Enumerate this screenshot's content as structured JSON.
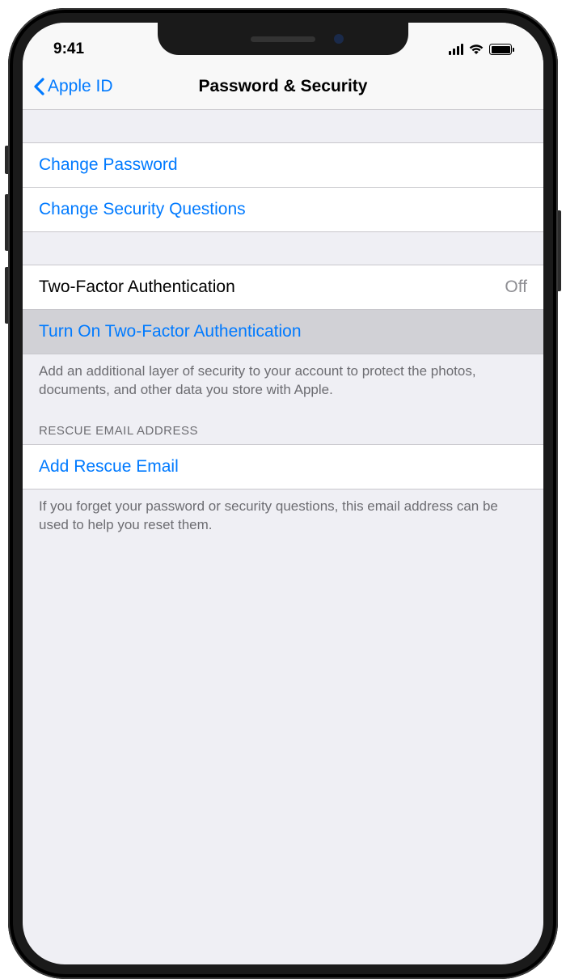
{
  "status_bar": {
    "time": "9:41"
  },
  "nav": {
    "back_label": "Apple ID",
    "title": "Password & Security"
  },
  "sections": {
    "change_password": "Change Password",
    "change_security_questions": "Change Security Questions",
    "two_factor_label": "Two-Factor Authentication",
    "two_factor_status": "Off",
    "turn_on_2fa": "Turn On Two-Factor Authentication",
    "two_factor_footer": "Add an additional layer of security to your account to protect the photos, documents, and other data you store with Apple.",
    "rescue_header": "RESCUE EMAIL ADDRESS",
    "add_rescue_email": "Add Rescue Email",
    "rescue_footer": "If you forget your password or security questions, this email address can be used to help you reset them."
  },
  "colors": {
    "link": "#007aff",
    "background": "#efeff4",
    "separator": "#c8c7cc",
    "footer_text": "#6d6d72"
  }
}
